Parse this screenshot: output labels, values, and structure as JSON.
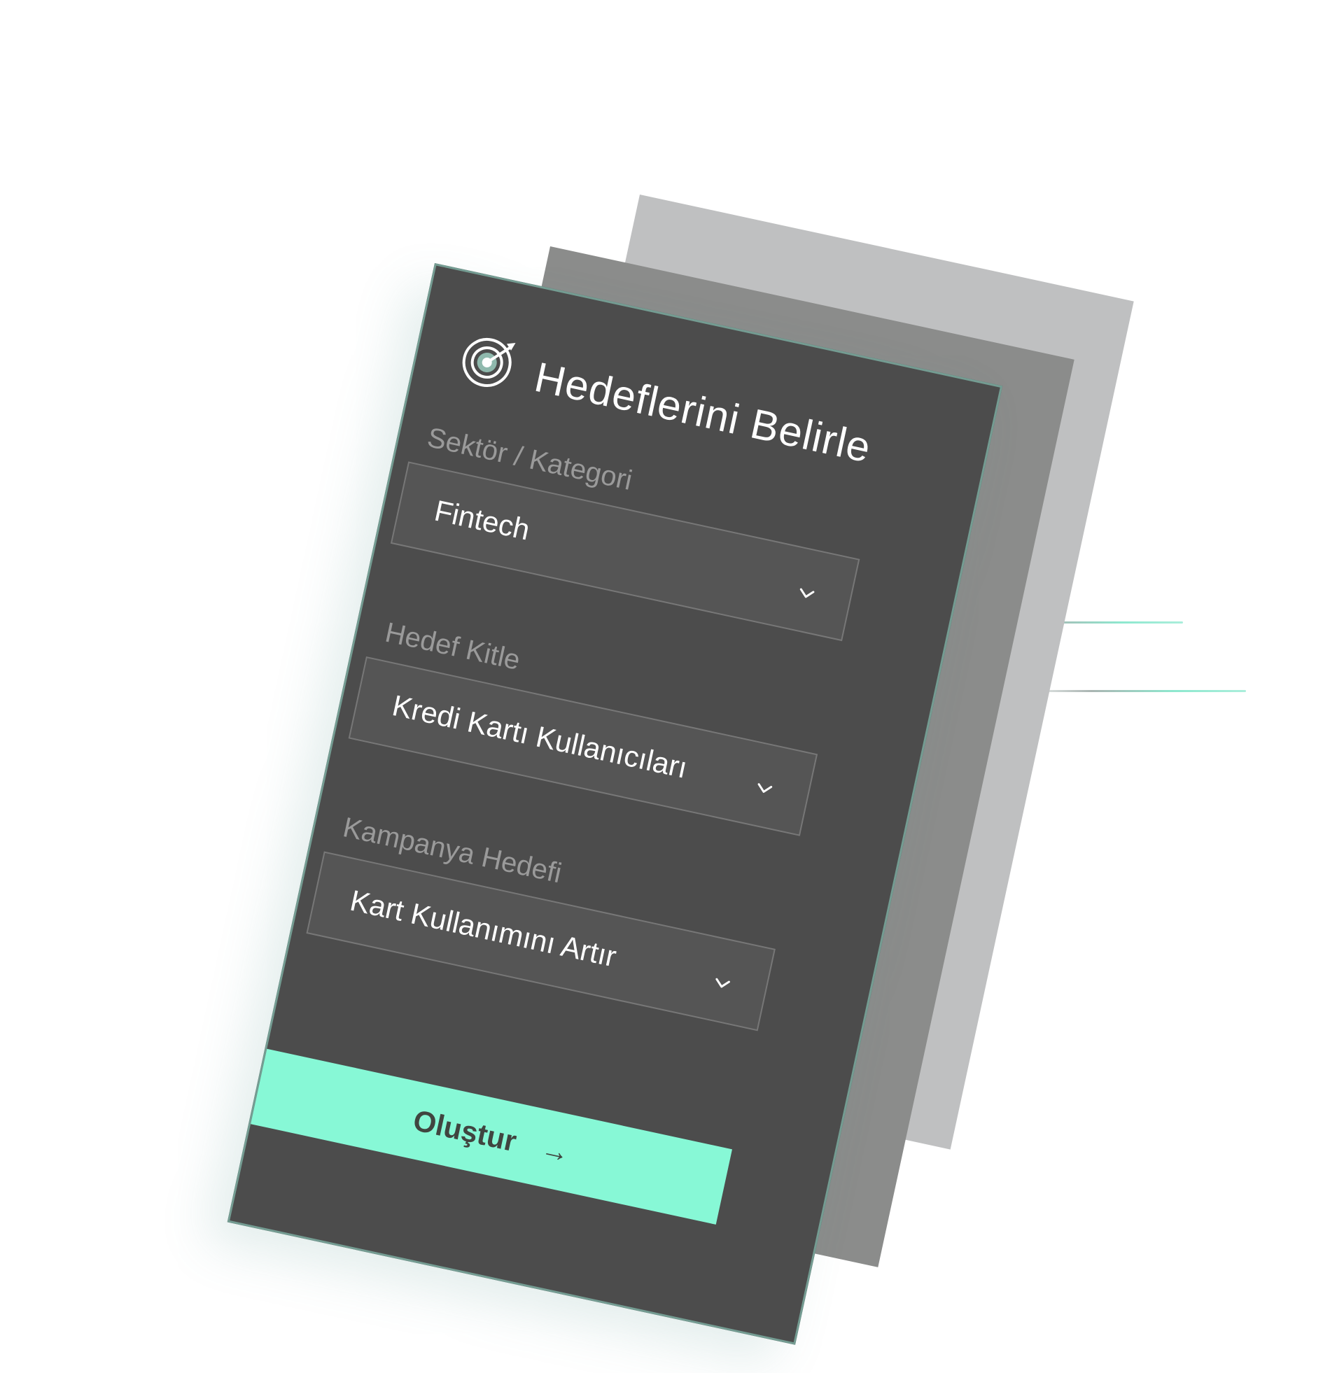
{
  "form": {
    "title": "Hedeflerini Belirle",
    "fields": [
      {
        "label": "Sektör / Kategori",
        "value": "Fintech"
      },
      {
        "label": "Hedef Kitle",
        "value": "Kredi Kartı Kullanıcıları"
      },
      {
        "label": "Kampanya Hedefi",
        "value": "Kart Kullanımını Artır"
      }
    ],
    "submit_label": "Oluştur",
    "submit_arrow": "→"
  },
  "icons": {
    "title_icon": "target-icon",
    "field_icon": "chevron-down-icon",
    "button_icon": "arrow-right-icon"
  },
  "colors": {
    "card_background": "#4c4c4c",
    "field_background": "#555555",
    "accent": "#87f8d6",
    "label": "#9a9a9a",
    "text": "#ffffff",
    "card_border": "#749c92"
  }
}
